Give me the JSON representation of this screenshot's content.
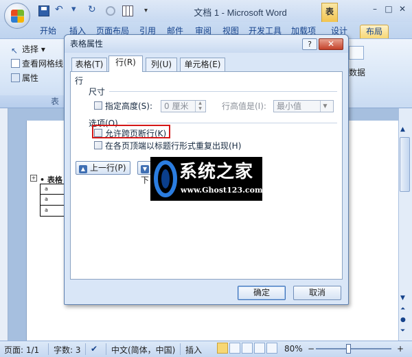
{
  "window": {
    "title": "文档 1 - Microsoft Word",
    "tools_tab": "表",
    "controls": {
      "minimize": "–",
      "maximize": "□",
      "close": "✕"
    }
  },
  "quick_access": {
    "more": "▾"
  },
  "ribbon": {
    "tabs": [
      "开始",
      "插入",
      "页面布局",
      "引用",
      "邮件",
      "审阅",
      "视图",
      "开发工具",
      "加载项",
      "设计",
      "布局"
    ],
    "active_tab": "布局",
    "group": {
      "label": "表",
      "items": [
        "选择 ▾",
        "查看网格线",
        "属性"
      ]
    },
    "right_label": "数据"
  },
  "document": {
    "table_label": "• 表格",
    "rows": [
      "a",
      "a",
      "a"
    ]
  },
  "dialog": {
    "title": "表格属性",
    "help": "?",
    "close": "✕",
    "tabs": [
      "表格(T)",
      "行(R)",
      "列(U)",
      "单元格(E)"
    ],
    "active_tab": "行(R)",
    "section_row": "行",
    "size_label": "尺寸",
    "specify_height": "指定高度(S):",
    "height_value": "0 厘米",
    "row_height_label": "行高值是(I):",
    "row_height_rule": "最小值",
    "options_label": "选项(O)",
    "allow_break": "允许跨页断行(K)",
    "repeat_header": "在各页顶端以标题行形式重复出现(H)",
    "prev_row": "上一行(P)",
    "next_row": "下",
    "ok": "确定",
    "cancel": "取消"
  },
  "watermark": {
    "title": "系统之家",
    "url": "www.Ghost123.com"
  },
  "statusbar": {
    "page": "页面: 1/1",
    "words": "字数: 3",
    "language": "中文(简体，中国)",
    "insert_mode": "插入",
    "zoom": "80%",
    "zoom_minus": "−",
    "zoom_plus": "+"
  },
  "colors": {
    "highlight": "#d41717",
    "accent": "#15428b",
    "active_tab": "#f7d774"
  }
}
